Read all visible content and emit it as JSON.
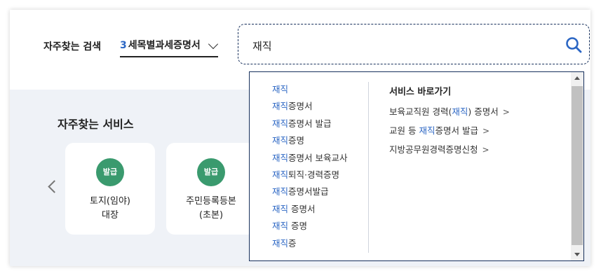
{
  "header": {
    "frequent_search_label": "자주찾는 검색",
    "select_number": "3",
    "select_value": "세목별과세증명서"
  },
  "search": {
    "value": "재직"
  },
  "services": {
    "title": "자주찾는 서비스",
    "cards": [
      {
        "badge": "발급",
        "line1": "토지(임야)",
        "line2": "대장"
      },
      {
        "badge": "발급",
        "line1": "주민등록등본",
        "line2": "(초본)"
      }
    ]
  },
  "dropdown": {
    "suggestions": [
      {
        "hl": "재직",
        "rest": ""
      },
      {
        "hl": "재직",
        "rest": "증명서"
      },
      {
        "hl": "재직",
        "rest": "증명서 발급"
      },
      {
        "hl": "재직",
        "rest": "증명"
      },
      {
        "hl": "재직",
        "rest": "증명서 보육교사"
      },
      {
        "hl": "재직",
        "rest": "퇴직·경력증명"
      },
      {
        "hl": "재직",
        "rest": "증명서발급"
      },
      {
        "hl": "재직",
        "rest": " 증명서"
      },
      {
        "hl": "재직",
        "rest": " 증명"
      },
      {
        "hl": "재직",
        "rest": "증"
      }
    ],
    "quick_title": "서비스 바로가기",
    "quick_links": [
      {
        "pre": "보육교직원 경력(",
        "hl": "재직",
        "post": ") 증명서"
      },
      {
        "pre": "교원 등 ",
        "hl": "재직",
        "post": "증명서 발급"
      },
      {
        "pre": "지방공무원경력증명신청",
        "hl": "",
        "post": ""
      }
    ],
    "arrow": ">"
  },
  "colors": {
    "accent": "#2b66c4",
    "badge": "#3a9a6e",
    "border": "#17305c",
    "background": "#eff2f7"
  },
  "icons": {
    "search": "search-icon",
    "select_chevron": "chevron-down-icon",
    "carousel_prev": "chevron-left-icon"
  }
}
